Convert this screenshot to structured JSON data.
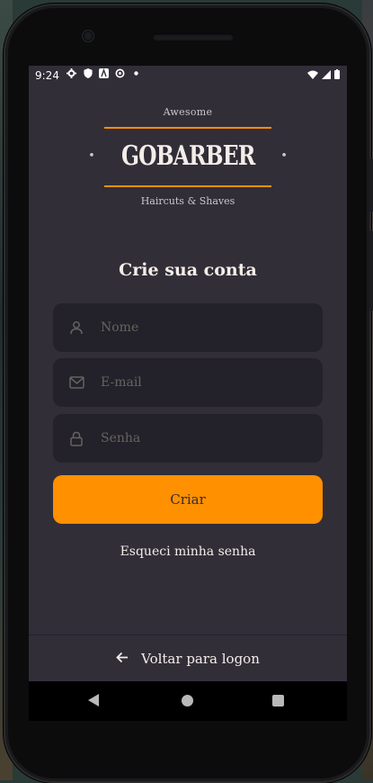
{
  "status_bar": {
    "time": "9:24",
    "icons": [
      "gear-icon",
      "shield-icon",
      "a-icon",
      "sync-icon",
      "dot-icon"
    ],
    "right_icons": [
      "wifi-icon",
      "signal-icon",
      "battery-icon"
    ]
  },
  "logo": {
    "top_text": "Awesome",
    "brand": "GOBARBER",
    "bottom_text": "Haircuts & Shaves",
    "accent": "#ff9000"
  },
  "form": {
    "title": "Crie sua conta",
    "name_placeholder": "Nome",
    "email_placeholder": "E-mail",
    "password_placeholder": "Senha",
    "submit_label": "Criar"
  },
  "forgot_label": "Esqueci minha senha",
  "footer": {
    "back_label": "Voltar para logon"
  },
  "nav_bar": [
    "back-icon",
    "home-icon",
    "recents-icon"
  ],
  "colors": {
    "background": "#312e38",
    "input_bg": "#232129",
    "placeholder": "#666360",
    "text": "#f4ede8",
    "accent": "#ff9000"
  }
}
